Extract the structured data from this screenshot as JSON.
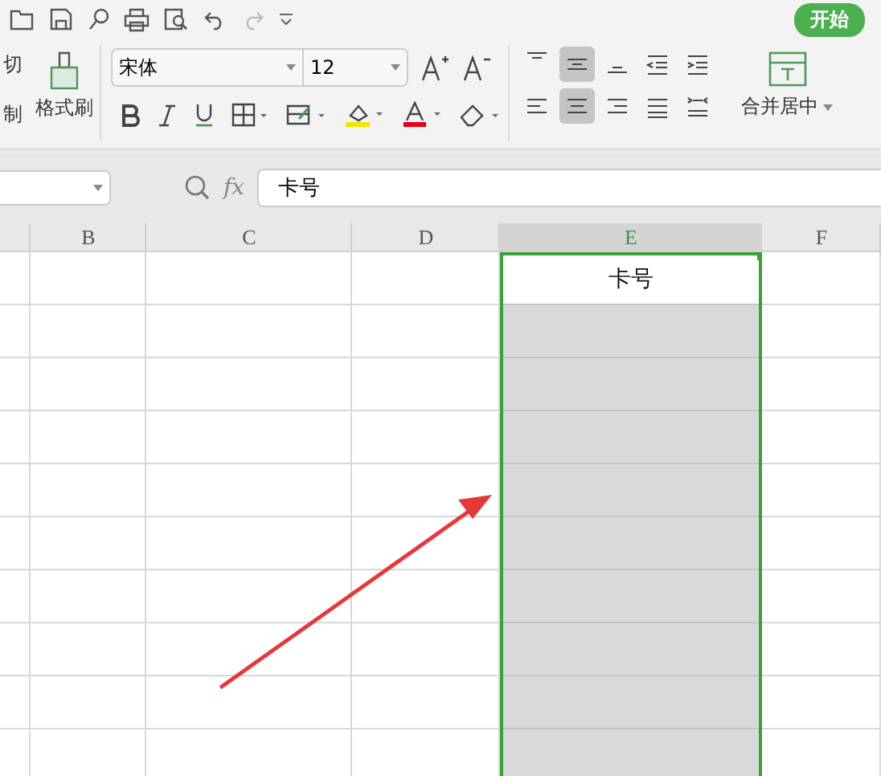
{
  "quick_toolbar": {
    "start_button": "开始"
  },
  "ribbon": {
    "clipboard": {
      "cut_label": "切",
      "copy_label": "制",
      "format_painter": "格式刷"
    },
    "font": {
      "name": "宋体",
      "size": "12"
    },
    "alignment": {
      "buttons": [
        {
          "kind": "top",
          "selected": false
        },
        {
          "kind": "middle",
          "selected": true
        },
        {
          "kind": "bottom",
          "selected": false
        },
        {
          "kind": "outdent",
          "selected": false
        },
        {
          "kind": "indent",
          "selected": false
        },
        {
          "kind": "left",
          "selected": false
        },
        {
          "kind": "center",
          "selected": true
        },
        {
          "kind": "right",
          "selected": false
        },
        {
          "kind": "justify",
          "selected": false
        },
        {
          "kind": "distributed",
          "selected": false
        }
      ],
      "merge_label": "合并居中"
    }
  },
  "formula_bar": {
    "fx": "fx",
    "value": "卡号"
  },
  "sheet": {
    "columns": [
      {
        "selected": false
      },
      {
        "label": "B",
        "selected": false
      },
      {
        "label": "C",
        "selected": false
      },
      {
        "label": "D",
        "selected": false
      },
      {
        "label": "E",
        "selected": true,
        "cells": [
          "卡号"
        ]
      },
      {
        "label": "F",
        "selected": false
      }
    ]
  },
  "annotation": {
    "kind": "arrow"
  }
}
